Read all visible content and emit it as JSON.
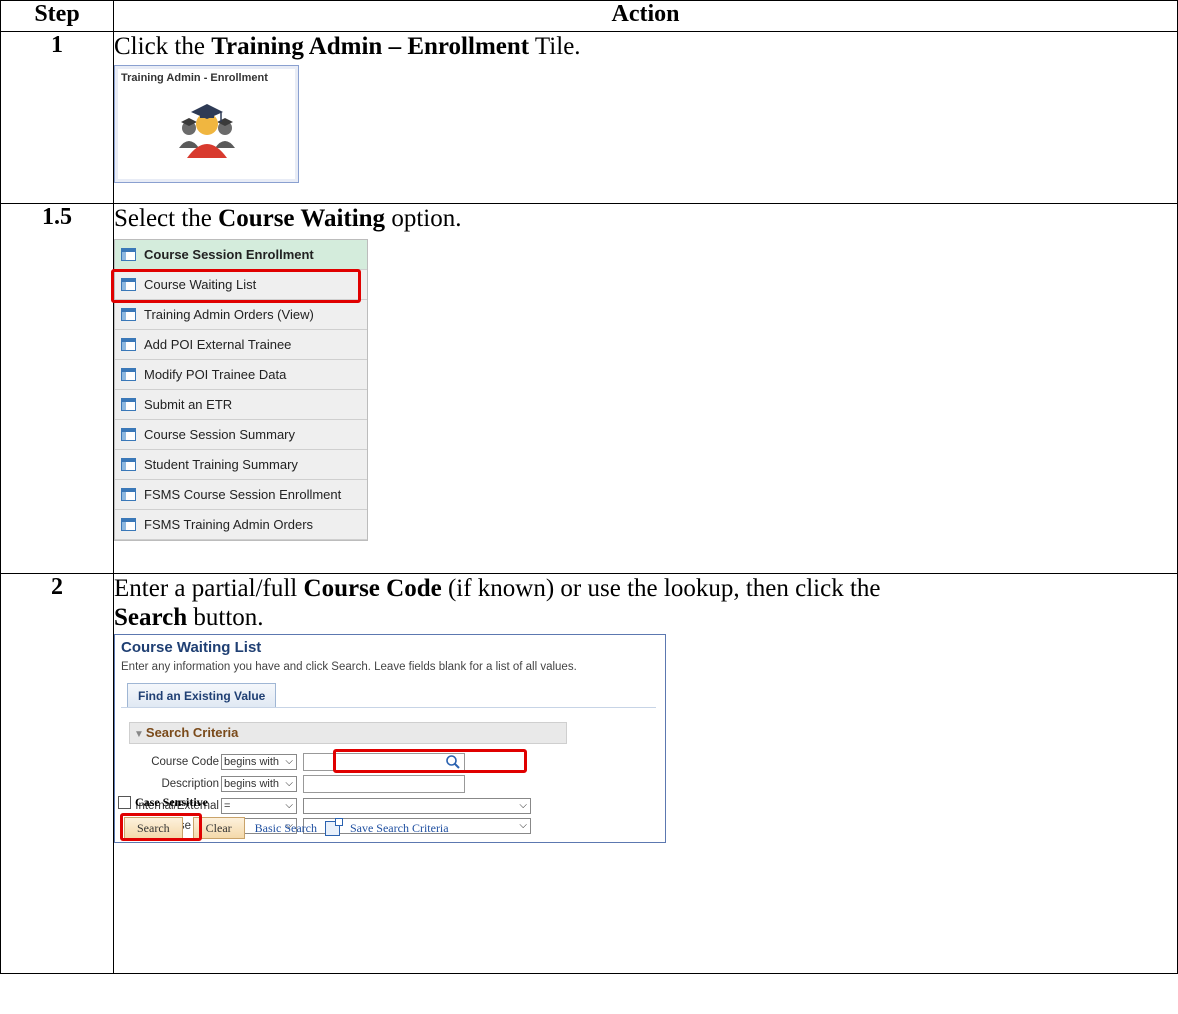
{
  "table": {
    "header_step": "Step",
    "header_action": "Action"
  },
  "rows": [
    {
      "step": "1",
      "pre": "Click the ",
      "bold": "Training Admin – Enrollment",
      "post": " Tile.",
      "tile": {
        "title": "Training Admin - Enrollment",
        "icon": "graduates-icon"
      }
    },
    {
      "step": "1.5",
      "pre": "Select the ",
      "bold": "Course Waiting",
      "post": " option.",
      "menu": [
        "Course Session Enrollment",
        "Course Waiting List",
        "Training Admin Orders (View)",
        "Add POI External Trainee",
        "Modify POI Trainee Data",
        "Submit an ETR",
        "Course Session Summary",
        "Student Training Summary",
        "FSMS Course Session Enrollment",
        "FSMS Training Admin Orders"
      ]
    },
    {
      "step": "2",
      "pre": "Enter a partial/full ",
      "bold": "Course Code",
      "mid": " (if known) or use the lookup, then click the",
      "bold2": "Search",
      "post": " button.",
      "panel": {
        "title": "Course Waiting List",
        "instructions": "Enter any information you have and click Search. Leave fields blank for a list of all values.",
        "tab": "Find an Existing Value",
        "criteria": "Search Criteria",
        "fields": [
          {
            "label": "Course Code",
            "operator": "begins with"
          },
          {
            "label": "Description",
            "operator": "begins with"
          },
          {
            "label": "Internal/External",
            "operator": "="
          },
          {
            "label": "Course Type",
            "operator": "="
          }
        ],
        "case_sensitive": "Case Sensitive",
        "search_btn": "Search",
        "clear_btn": "Clear",
        "basic_search": "Basic Search",
        "save_criteria": "Save Search Criteria"
      }
    }
  ],
  "colors": {
    "highlight": "#e00000",
    "menu_header": "#d4ecdc",
    "panel_title": "#1f3f73"
  }
}
